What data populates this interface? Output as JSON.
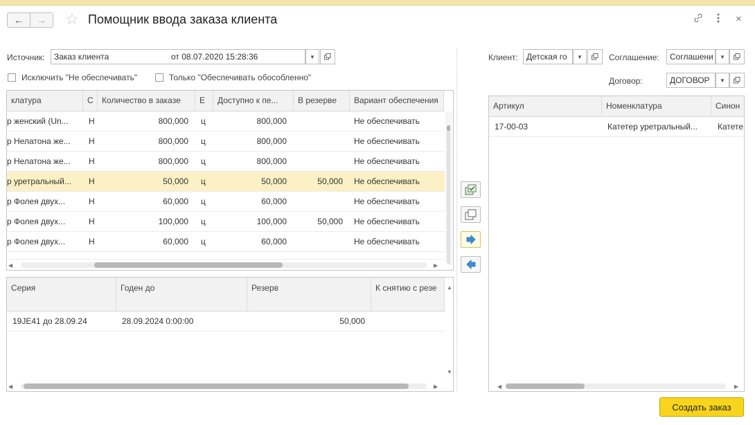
{
  "header": {
    "title": "Помощник ввода заказа клиента"
  },
  "source": {
    "label": "Источник:",
    "value": "Заказ клиента",
    "date": "от 08.07.2020 15:28:36"
  },
  "checkboxes": {
    "exclude": "Исключить \"Не обеспечивать\"",
    "only": "Только \"Обеспечивать обособленно\""
  },
  "client": {
    "label": "Клиент:",
    "value": "Детская го",
    "agreement_label": "Соглашение:",
    "agreement_value": "Соглашени",
    "contract_label": "Договор:",
    "contract_value": "ДОГОВОР"
  },
  "main_table": {
    "columns": [
      "клатура",
      "С",
      "Количество в заказе",
      "Е",
      "Доступно к пе...",
      "В резерве",
      "Вариант обеспечения"
    ],
    "rows": [
      [
        "р женский (Un...",
        "Н",
        "800,000",
        "ц",
        "800,000",
        "",
        "Не обеспечивать"
      ],
      [
        "р Нелатона же...",
        "Н",
        "800,000",
        "ц",
        "800,000",
        "",
        "Не обеспечивать"
      ],
      [
        "р Нелатона же...",
        "Н",
        "800,000",
        "ц",
        "800,000",
        "",
        "Не обеспечивать"
      ],
      [
        "р уретральный...",
        "Н",
        "50,000",
        "ц",
        "50,000",
        "50,000",
        "Не обеспечивать"
      ],
      [
        "р Фолея двух...",
        "Н",
        "60,000",
        "ц",
        "60,000",
        "",
        "Не обеспечивать"
      ],
      [
        "р Фолея двух...",
        "Н",
        "100,000",
        "ц",
        "100,000",
        "50,000",
        "Не обеспечивать"
      ],
      [
        "р Фолея двух...",
        "Н",
        "60,000",
        "ц",
        "60,000",
        "",
        "Не обеспечивать"
      ]
    ],
    "selected_row": 3
  },
  "series_table": {
    "columns": [
      "Серия",
      "Годен до",
      "Резерв",
      "К снятию с резе"
    ],
    "rows": [
      [
        "19JE41 до 28.09.24",
        "28.09.2024 0:00:00",
        "50,000",
        ""
      ]
    ]
  },
  "right_table": {
    "columns": [
      "Артикул",
      "Номенклатура",
      "Синон"
    ],
    "rows": [
      [
        "17-00-03",
        "Катетер уретральный...",
        "Катете"
      ]
    ]
  },
  "footer": {
    "create_label": "Создать заказ"
  }
}
